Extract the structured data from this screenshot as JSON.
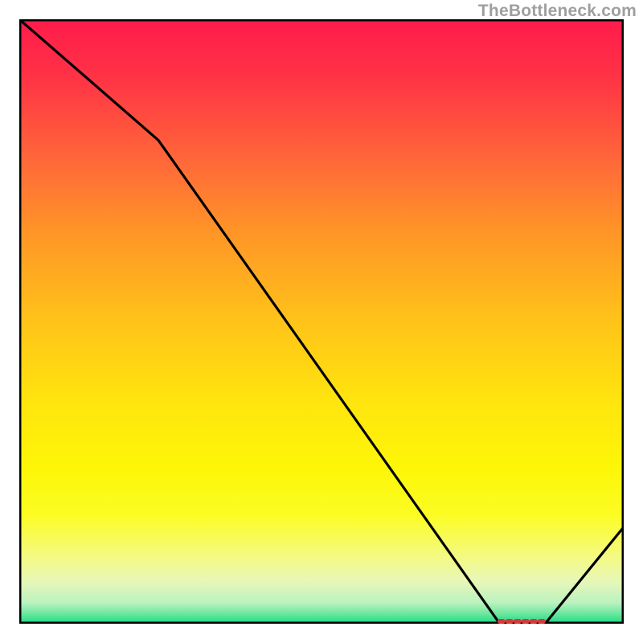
{
  "attribution": "TheBottleneck.com",
  "colors": {
    "frame": "#000000",
    "curve": "#000000",
    "marker": "#d13b3a",
    "top": "#ff1b4b",
    "bottom": "#12dc83"
  },
  "chart_data": {
    "type": "line",
    "title": "",
    "xlabel": "",
    "ylabel": "",
    "xlim": [
      0,
      100
    ],
    "ylim": [
      0,
      100
    ],
    "series": [
      {
        "name": "curve",
        "x": [
          0,
          23,
          79.5,
          87,
          100
        ],
        "y": [
          100,
          80,
          0,
          0,
          16
        ]
      }
    ],
    "minimum_marker": {
      "x_start": 79.5,
      "x_end": 87,
      "y": 0
    },
    "annotations": []
  }
}
